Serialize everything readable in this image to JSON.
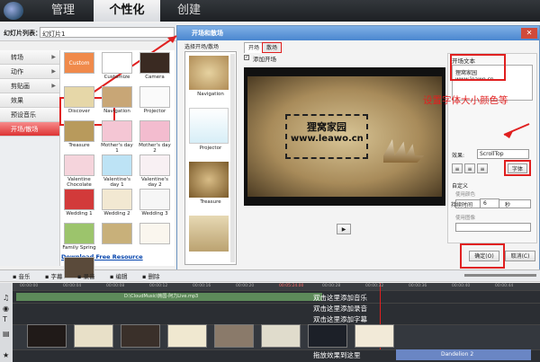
{
  "header": {
    "tabs": [
      "管理",
      "个性化",
      "创建"
    ],
    "active": "个性化"
  },
  "slide_list": {
    "label": "幻灯片列表：",
    "value": "幻灯片1"
  },
  "left_menu": [
    {
      "label": "转场",
      "arrow": true
    },
    {
      "label": "动作",
      "arrow": true
    },
    {
      "label": "剪贴画",
      "arrow": true
    },
    {
      "label": "效果",
      "arrow": false
    },
    {
      "label": "预设音乐",
      "arrow": false
    },
    {
      "label": "开场/散场",
      "arrow": false,
      "selected": true
    }
  ],
  "thumbs": [
    {
      "label": "Custom",
      "color": "#f08a4b"
    },
    {
      "label": "Customize",
      "color": "#ffffff"
    },
    {
      "label": "Camera",
      "color": "#3a2a22"
    },
    {
      "label": "Discover",
      "color": "#e6d7a8"
    },
    {
      "label": "Navigation",
      "color": "#c8a676"
    },
    {
      "label": "Projector",
      "color": "#fafafa"
    },
    {
      "label": "Treasure",
      "color": "#b89a5c"
    },
    {
      "label": "Mother's day 1",
      "color": "#f4c6d4"
    },
    {
      "label": "Mother's day 2",
      "color": "#f3bccf"
    },
    {
      "label": "Valentine Chocolate",
      "color": "#f5d4dc"
    },
    {
      "label": "Valentine's day 1",
      "color": "#bde3f5"
    },
    {
      "label": "Valentine's day 2",
      "color": "#f8f0f3"
    },
    {
      "label": "Wedding 1",
      "color": "#d23a3a"
    },
    {
      "label": "Wedding 2",
      "color": "#f2e8d2"
    },
    {
      "label": "Wedding 3",
      "color": "#f6f6f6"
    },
    {
      "label": "Family Spring",
      "color": "#9cc46c"
    },
    {
      "label": "",
      "color": "#c8b07a"
    },
    {
      "label": "",
      "color": "#faf6ee"
    },
    {
      "label": "",
      "color": "#5a4a3a"
    }
  ],
  "download_label": "Download Free Resource",
  "dialog": {
    "title": "开场和散场",
    "close": "✕",
    "chooser_title": "选择开场/散场",
    "chooser_items": [
      "Navigation",
      "Projector",
      "Treasure"
    ],
    "tabs": [
      "开场",
      "散场"
    ],
    "add_open": "添加开场",
    "preview_text1": "狸窝家园",
    "preview_text2": "www.leawo.cn",
    "play": "▶"
  },
  "panel": {
    "open_text_label": "开场文本",
    "open_text_value1": "狸窝家园",
    "open_text_value2": "www.leawo.cn",
    "effect_label": "效果:",
    "effect_value": "ScrollTop",
    "font_button": "字体",
    "custom": "自定义",
    "use_color": "使用颜色",
    "use_image": "使用图像",
    "duration_label": "持续时间",
    "duration_value": "6",
    "seconds": "秒",
    "ok": "确定(O)",
    "cancel": "取消(C)"
  },
  "annotation": "设置字体大小颜色等",
  "timeline": {
    "tools": [
      "音乐",
      "字幕",
      "录音",
      "编辑",
      "删除"
    ],
    "ruler": [
      "00:00:00",
      "00:00:04",
      "00:00:08",
      "00:00:12",
      "00:00:16",
      "00:00:20",
      "00:05:24.00",
      "00:00:28",
      "00:00:32",
      "00:00:36",
      "00:00:40",
      "00:00:44"
    ],
    "audio_path": "D:\\CloudMusic\\韩国-阿力Live.mp3",
    "hint_lines": [
      "双击这里添加音乐",
      "双击这里添加录音",
      "双击这里添加字幕",
      "拖放效果到这里"
    ],
    "dandelion": "Dandelion 2"
  }
}
